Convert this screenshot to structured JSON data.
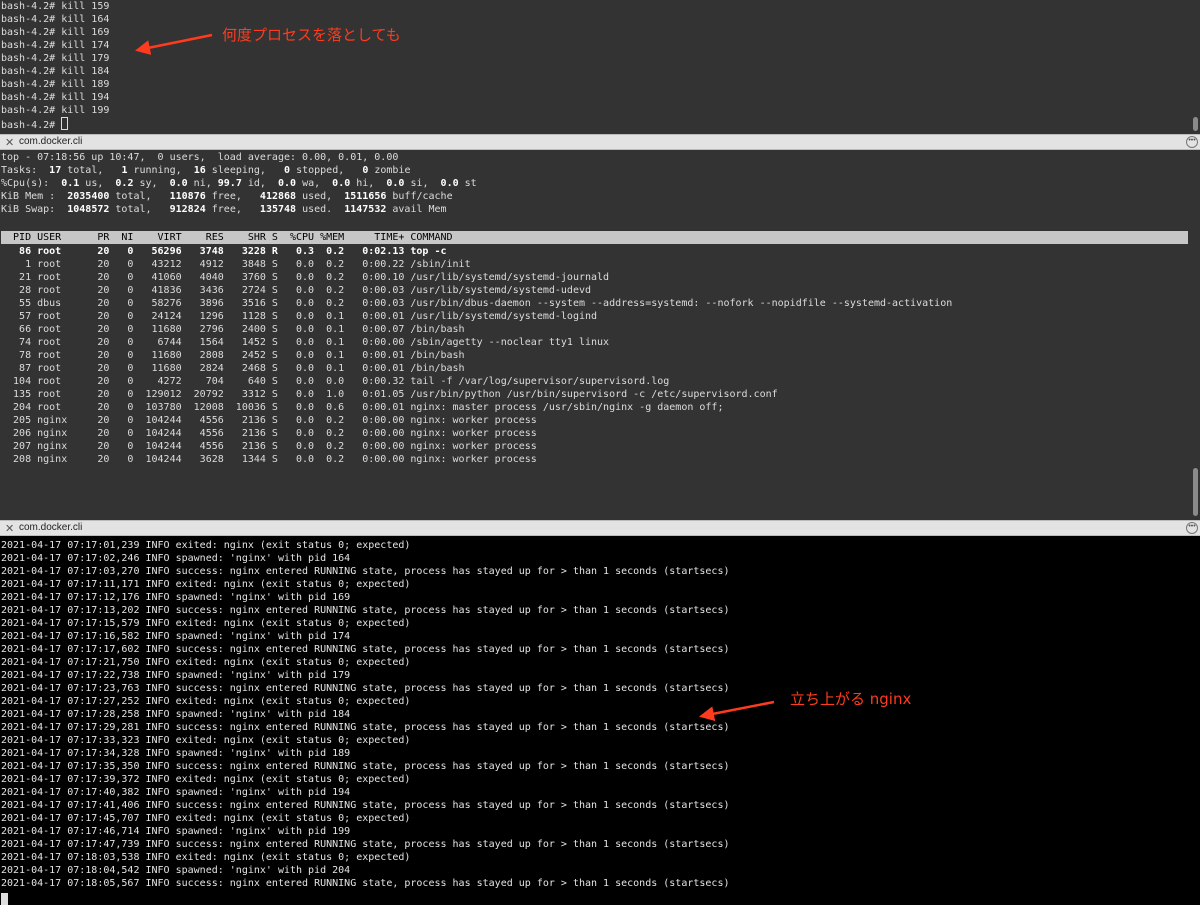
{
  "pane_top": {
    "lines": [
      "bash-4.2# kill 159",
      "bash-4.2# kill 164",
      "bash-4.2# kill 169",
      "bash-4.2# kill 174",
      "bash-4.2# kill 179",
      "bash-4.2# kill 184",
      "bash-4.2# kill 189",
      "bash-4.2# kill 194",
      "bash-4.2# kill 199"
    ],
    "prompt": "bash-4.2# "
  },
  "tab1": {
    "title": "com.docker.cli"
  },
  "tab2": {
    "title": "com.docker.cli"
  },
  "top": {
    "header": [
      "top - 07:18:56 up 10:47,  0 users,  load average: 0.00, 0.01, 0.00",
      "Tasks:  17 total,   1 running,  16 sleeping,   0 stopped,   0 zombie",
      "%Cpu(s):  0.1 us,  0.2 sy,  0.0 ni, 99.7 id,  0.0 wa,  0.0 hi,  0.0 si,  0.0 st",
      "KiB Mem :  2035400 total,   110876 free,   412868 used,  1511656 buff/cache",
      "KiB Swap:  1048572 total,   912824 free,   135748 used.  1147532 avail Mem"
    ],
    "columns": "  PID USER      PR  NI    VIRT    RES    SHR S  %CPU %MEM     TIME+ COMMAND",
    "rows": [
      "   86 root      20   0   56296   3748   3228 R   0.3  0.2   0:02.13 top -c",
      "    1 root      20   0   43212   4912   3848 S   0.0  0.2   0:00.22 /sbin/init",
      "   21 root      20   0   41060   4040   3760 S   0.0  0.2   0:00.10 /usr/lib/systemd/systemd-journald",
      "   28 root      20   0   41836   3436   2724 S   0.0  0.2   0:00.03 /usr/lib/systemd/systemd-udevd",
      "   55 dbus      20   0   58276   3896   3516 S   0.0  0.2   0:00.03 /usr/bin/dbus-daemon --system --address=systemd: --nofork --nopidfile --systemd-activation",
      "   57 root      20   0   24124   1296   1128 S   0.0  0.1   0:00.01 /usr/lib/systemd/systemd-logind",
      "   66 root      20   0   11680   2796   2400 S   0.0  0.1   0:00.07 /bin/bash",
      "   74 root      20   0    6744   1564   1452 S   0.0  0.1   0:00.00 /sbin/agetty --noclear tty1 linux",
      "   78 root      20   0   11680   2808   2452 S   0.0  0.1   0:00.01 /bin/bash",
      "   87 root      20   0   11680   2824   2468 S   0.0  0.1   0:00.01 /bin/bash",
      "  104 root      20   0    4272    704    640 S   0.0  0.0   0:00.32 tail -f /var/log/supervisor/supervisord.log",
      "  135 root      20   0  129012  20792   3312 S   0.0  1.0   0:01.05 /usr/bin/python /usr/bin/supervisord -c /etc/supervisord.conf",
      "  204 root      20   0  103780  12008  10036 S   0.0  0.6   0:00.01 nginx: master process /usr/sbin/nginx -g daemon off;",
      "  205 nginx     20   0  104244   4556   2136 S   0.0  0.2   0:00.00 nginx: worker process",
      "  206 nginx     20   0  104244   4556   2136 S   0.0  0.2   0:00.00 nginx: worker process",
      "  207 nginx     20   0  104244   4556   2136 S   0.0  0.2   0:00.00 nginx: worker process",
      "  208 nginx     20   0  104244   3628   1344 S   0.0  0.2   0:00.00 nginx: worker process"
    ]
  },
  "log": {
    "lines": [
      "2021-04-17 07:17:01,239 INFO exited: nginx (exit status 0; expected)",
      "2021-04-17 07:17:02,246 INFO spawned: 'nginx' with pid 164",
      "2021-04-17 07:17:03,270 INFO success: nginx entered RUNNING state, process has stayed up for > than 1 seconds (startsecs)",
      "2021-04-17 07:17:11,171 INFO exited: nginx (exit status 0; expected)",
      "2021-04-17 07:17:12,176 INFO spawned: 'nginx' with pid 169",
      "2021-04-17 07:17:13,202 INFO success: nginx entered RUNNING state, process has stayed up for > than 1 seconds (startsecs)",
      "2021-04-17 07:17:15,579 INFO exited: nginx (exit status 0; expected)",
      "2021-04-17 07:17:16,582 INFO spawned: 'nginx' with pid 174",
      "2021-04-17 07:17:17,602 INFO success: nginx entered RUNNING state, process has stayed up for > than 1 seconds (startsecs)",
      "2021-04-17 07:17:21,750 INFO exited: nginx (exit status 0; expected)",
      "2021-04-17 07:17:22,738 INFO spawned: 'nginx' with pid 179",
      "2021-04-17 07:17:23,763 INFO success: nginx entered RUNNING state, process has stayed up for > than 1 seconds (startsecs)",
      "2021-04-17 07:17:27,252 INFO exited: nginx (exit status 0; expected)",
      "2021-04-17 07:17:28,258 INFO spawned: 'nginx' with pid 184",
      "2021-04-17 07:17:29,281 INFO success: nginx entered RUNNING state, process has stayed up for > than 1 seconds (startsecs)",
      "2021-04-17 07:17:33,323 INFO exited: nginx (exit status 0; expected)",
      "2021-04-17 07:17:34,328 INFO spawned: 'nginx' with pid 189",
      "2021-04-17 07:17:35,350 INFO success: nginx entered RUNNING state, process has stayed up for > than 1 seconds (startsecs)",
      "2021-04-17 07:17:39,372 INFO exited: nginx (exit status 0; expected)",
      "2021-04-17 07:17:40,382 INFO spawned: 'nginx' with pid 194",
      "2021-04-17 07:17:41,406 INFO success: nginx entered RUNNING state, process has stayed up for > than 1 seconds (startsecs)",
      "2021-04-17 07:17:45,707 INFO exited: nginx (exit status 0; expected)",
      "2021-04-17 07:17:46,714 INFO spawned: 'nginx' with pid 199",
      "2021-04-17 07:17:47,739 INFO success: nginx entered RUNNING state, process has stayed up for > than 1 seconds (startsecs)",
      "2021-04-17 07:18:03,538 INFO exited: nginx (exit status 0; expected)",
      "2021-04-17 07:18:04,542 INFO spawned: 'nginx' with pid 204",
      "2021-04-17 07:18:05,567 INFO success: nginx entered RUNNING state, process has stayed up for > than 1 seconds (startsecs)"
    ]
  },
  "annotations": {
    "kill_note": "何度プロセスを落としても",
    "nginx_note": "立ち上がる nginx"
  },
  "colors": {
    "annotation": "#ff3b1f",
    "pane_bg": "#333333",
    "log_bg": "#000000"
  }
}
